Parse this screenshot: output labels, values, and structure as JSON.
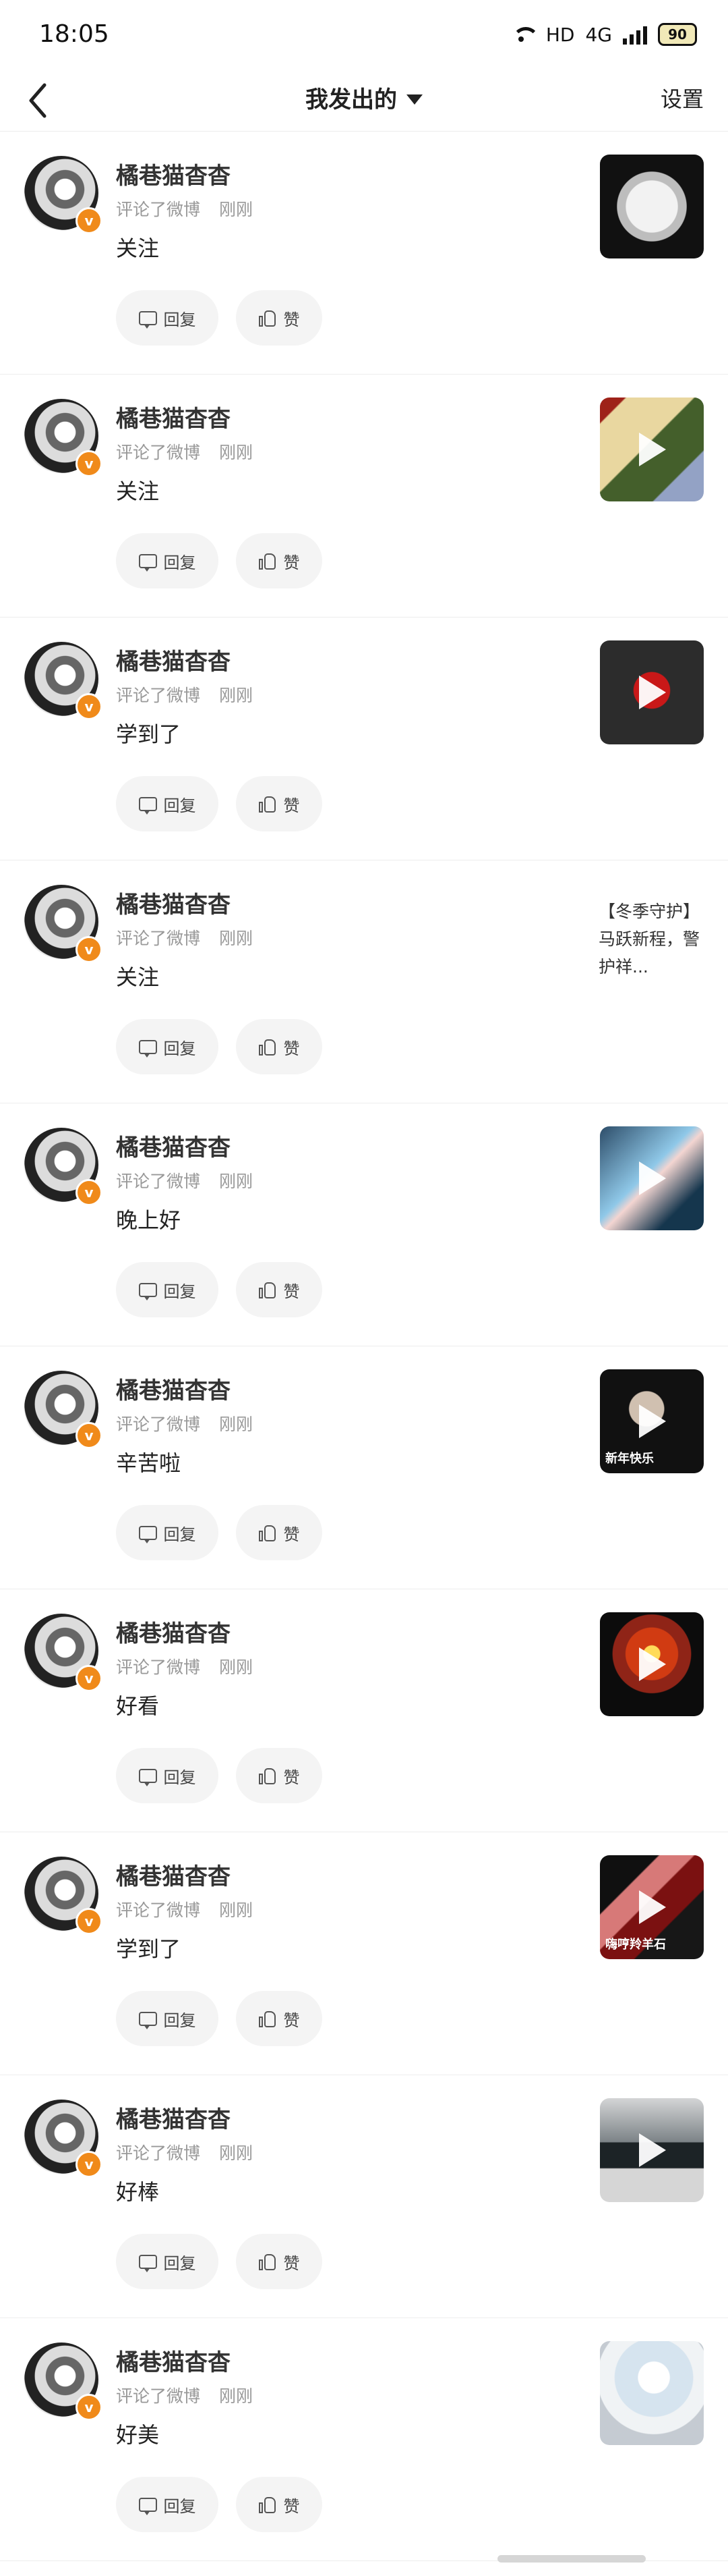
{
  "status_bar": {
    "time": "18:05",
    "network": "HD",
    "signal": "4G",
    "battery": "90"
  },
  "nav": {
    "title": "我发出的",
    "settings": "设置"
  },
  "items": [
    {
      "user_name": "橘巷猫杳杳",
      "action": "评论了微博",
      "time": "刚刚",
      "comment": "关注",
      "reply_label": "回复",
      "like_label": "赞",
      "badge": "v",
      "thumbnail": {
        "caption": "",
        "text": ""
      }
    },
    {
      "user_name": "橘巷猫杳杳",
      "action": "评论了微博",
      "time": "刚刚",
      "comment": "关注",
      "reply_label": "回复",
      "like_label": "赞",
      "badge": "v",
      "thumbnail": {
        "caption": "",
        "text": ""
      }
    },
    {
      "user_name": "橘巷猫杳杳",
      "action": "评论了微博",
      "time": "刚刚",
      "comment": "学到了",
      "reply_label": "回复",
      "like_label": "赞",
      "badge": "v",
      "thumbnail": {
        "caption": "",
        "text": ""
      }
    },
    {
      "user_name": "橘巷猫杳杳",
      "action": "评论了微博",
      "time": "刚刚",
      "comment": "关注",
      "reply_label": "回复",
      "like_label": "赞",
      "badge": "v",
      "thumbnail": {
        "caption": "",
        "text": "【冬季守护】马跃新程，警护祥..."
      }
    },
    {
      "user_name": "橘巷猫杳杳",
      "action": "评论了微博",
      "time": "刚刚",
      "comment": "晚上好",
      "reply_label": "回复",
      "like_label": "赞",
      "badge": "v",
      "thumbnail": {
        "caption": "",
        "text": ""
      }
    },
    {
      "user_name": "橘巷猫杳杳",
      "action": "评论了微博",
      "time": "刚刚",
      "comment": "辛苦啦",
      "reply_label": "回复",
      "like_label": "赞",
      "badge": "v",
      "thumbnail": {
        "caption": "新年快乐",
        "text": ""
      }
    },
    {
      "user_name": "橘巷猫杳杳",
      "action": "评论了微博",
      "time": "刚刚",
      "comment": "好看",
      "reply_label": "回复",
      "like_label": "赞",
      "badge": "v",
      "thumbnail": {
        "caption": "",
        "text": ""
      }
    },
    {
      "user_name": "橘巷猫杳杳",
      "action": "评论了微博",
      "time": "刚刚",
      "comment": "学到了",
      "reply_label": "回复",
      "like_label": "赞",
      "badge": "v",
      "thumbnail": {
        "caption": "嗨哼羚羊石",
        "text": ""
      }
    },
    {
      "user_name": "橘巷猫杳杳",
      "action": "评论了微博",
      "time": "刚刚",
      "comment": "好棒",
      "reply_label": "回复",
      "like_label": "赞",
      "badge": "v",
      "thumbnail": {
        "caption": "",
        "text": ""
      }
    },
    {
      "user_name": "橘巷猫杳杳",
      "action": "评论了微博",
      "time": "刚刚",
      "comment": "好美",
      "reply_label": "回复",
      "like_label": "赞",
      "badge": "v",
      "thumbnail": {
        "caption": "",
        "text": ""
      }
    }
  ]
}
